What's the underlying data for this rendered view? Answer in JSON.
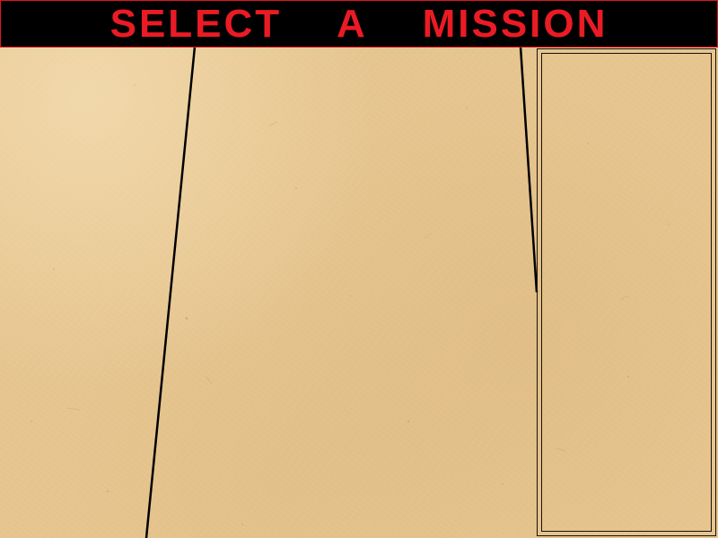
{
  "screen": {
    "title": "SELECT  A  MISSION",
    "colors": {
      "title_text": "#ea1b25",
      "title_background": "#000000",
      "title_border": "#e0141e",
      "paper_background": "#e6c58f",
      "line_color": "#000000"
    }
  },
  "map_area": {
    "region_divider_count": 2
  },
  "mission_panel": {
    "items": []
  }
}
